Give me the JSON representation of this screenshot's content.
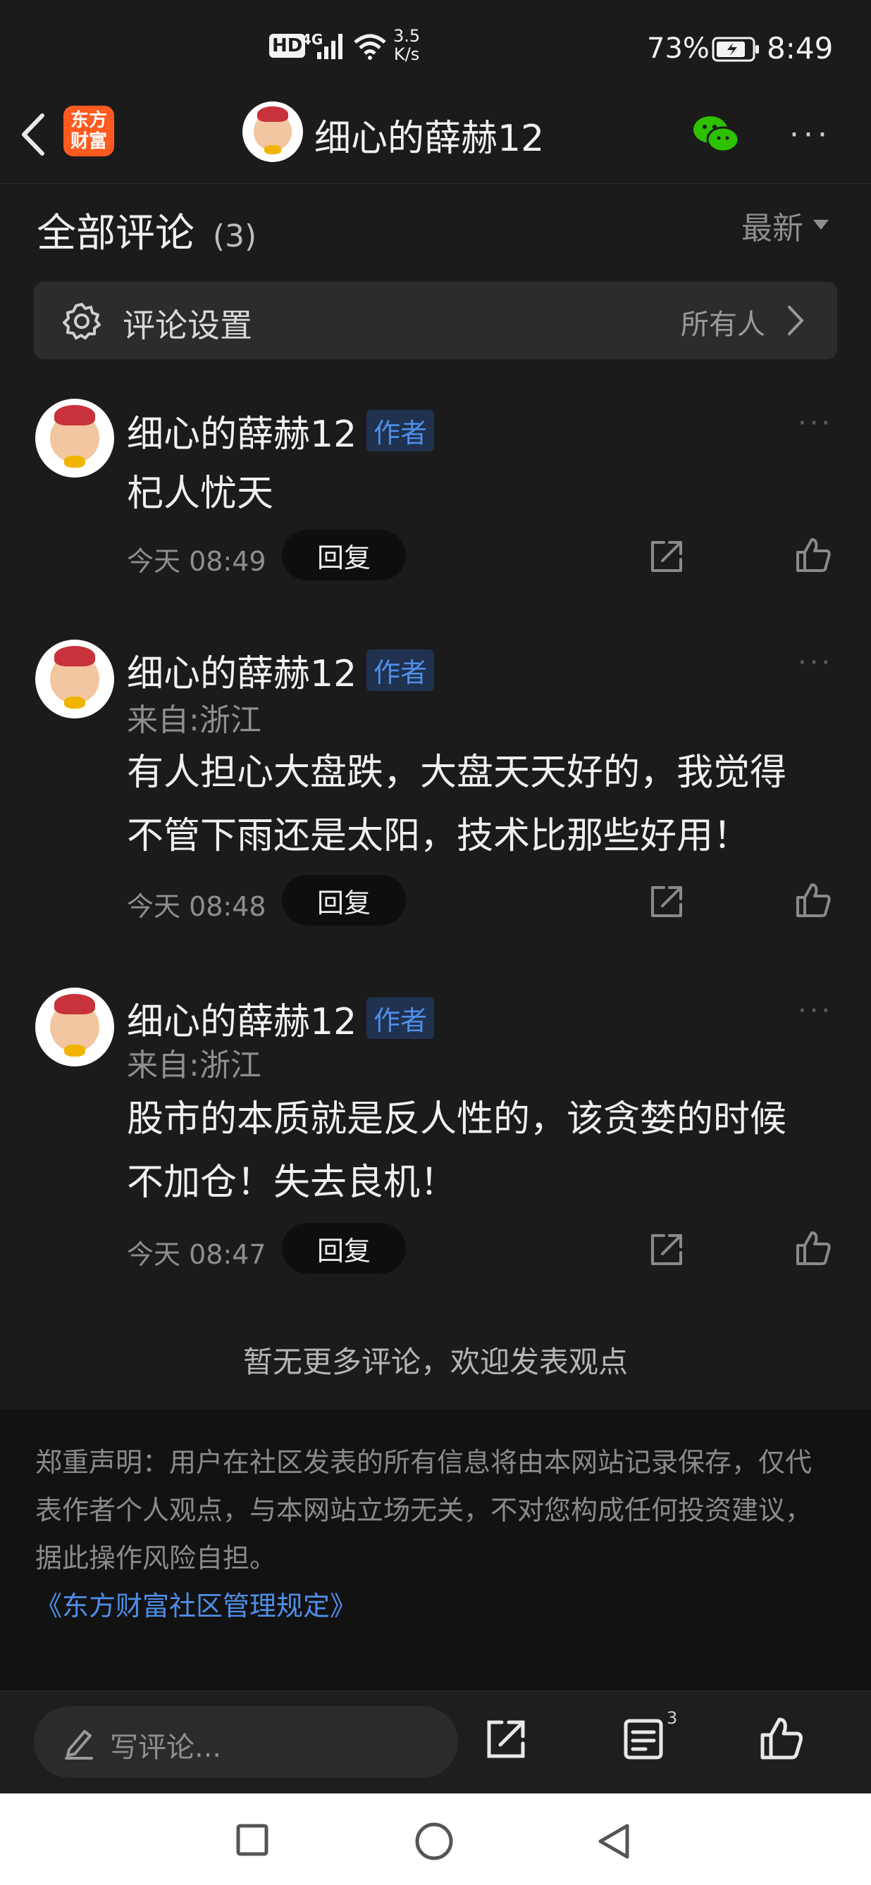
{
  "status_bar": {
    "network_hd": "HD",
    "network_gen": "4G",
    "speed_value": "3.5",
    "speed_unit": "K/s",
    "battery_pct": "73%",
    "time": "8:49"
  },
  "header": {
    "app_logo_line1": "东方",
    "app_logo_line2": "财富",
    "title": "细心的薛赫12"
  },
  "comments_section": {
    "heading": "全部评论",
    "count": "(3)",
    "sort_label": "最新"
  },
  "settings": {
    "label": "评论设置",
    "value": "所有人"
  },
  "comments": [
    {
      "author": "细心的薛赫12",
      "tag": "作者",
      "location": "",
      "text_lines": [
        "杞人忧天"
      ],
      "time": "今天 08:49",
      "reply_label": "回复"
    },
    {
      "author": "细心的薛赫12",
      "tag": "作者",
      "location": "来自:浙江",
      "text_lines": [
        "有人担心大盘跌，大盘天天好的，我觉得",
        "不管下雨还是太阳，技术比那些好用！"
      ],
      "time": "今天 08:48",
      "reply_label": "回复"
    },
    {
      "author": "细心的薛赫12",
      "tag": "作者",
      "location": "来自:浙江",
      "text_lines": [
        "股市的本质就是反人性的，该贪婪的时候",
        "不加仓！失去良机！"
      ],
      "time": "今天 08:47",
      "reply_label": "回复"
    }
  ],
  "no_more": "暂无更多评论，欢迎发表观点",
  "disclaimer": {
    "lines": [
      "郑重声明：用户在社区发表的所有信息将由本网站记录保存，仅代",
      "表作者个人观点，与本网站立场无关，不对您构成任何投资建议，",
      "据此操作风险自担。"
    ],
    "link": "《东方财富社区管理规定》"
  },
  "bottom_bar": {
    "input_placeholder": "写评论...",
    "comment_count_badge": "3"
  },
  "colors": {
    "background": "#1b1b1b",
    "author_tag": "#4f8ee8",
    "link": "#4f8ee8",
    "logo": "#ff5a1f",
    "wechat": "#2dc100"
  },
  "icons": [
    "back-arrow-icon",
    "wechat-icon",
    "more-icon",
    "gear-icon",
    "chevron-right-icon",
    "share-icon",
    "like-icon",
    "pencil-icon",
    "comments-list-icon",
    "home-square-icon",
    "home-circle-icon",
    "back-triangle-icon",
    "battery-icon",
    "signal-icon",
    "wifi-icon",
    "sort-dropdown-icon"
  ]
}
